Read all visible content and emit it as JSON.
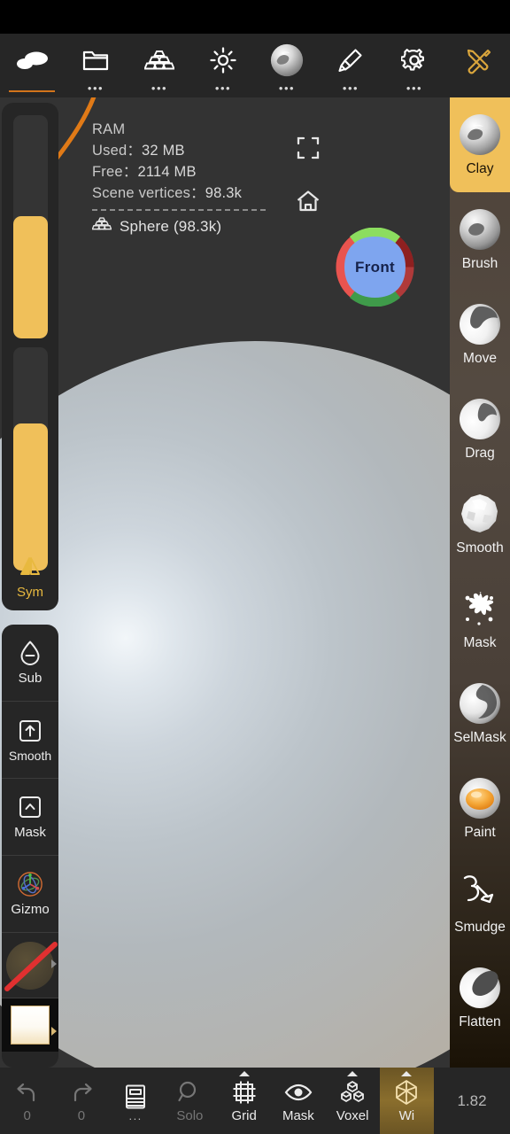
{
  "app": {
    "version": "1.82",
    "accent_gold": "#f0c05a",
    "accent_orange": "#d2741b",
    "panel_bg": "#262626",
    "viewport_bg": "#333333"
  },
  "topbar": {
    "items": [
      {
        "name": "sculpt",
        "icon": "clay-blob-icon",
        "dots": false,
        "active": true
      },
      {
        "name": "files",
        "icon": "folder-icon",
        "dots": true,
        "active": false
      },
      {
        "name": "topology",
        "icon": "stacked-blocks-icon",
        "dots": true,
        "active": false
      },
      {
        "name": "lighting",
        "icon": "sun-icon",
        "dots": true,
        "active": false
      },
      {
        "name": "material",
        "icon": "material-sphere-icon",
        "dots": true,
        "active": false
      },
      {
        "name": "paint",
        "icon": "paintbrush-icon",
        "dots": true,
        "active": false
      },
      {
        "name": "settings",
        "icon": "gear-icon",
        "dots": true,
        "active": false
      },
      {
        "name": "tools",
        "icon": "wrench-screwdriver-icon",
        "dots": false,
        "active": false
      }
    ]
  },
  "scene_info": {
    "ram_title": "RAM",
    "used_label": "Used：",
    "used_value": "32 MB",
    "free_label": "Free：",
    "free_value": "2114 MB",
    "vertices_label": "Scene vertices：",
    "vertices_value": "98.3k",
    "object_name": "Sphere (98.3k)"
  },
  "viewport": {
    "fullscreen_icon": "fullscreen-icon",
    "home_icon": "home-icon",
    "viewcube_label": "Front"
  },
  "left_panel": {
    "brush_size_label": "brush-size",
    "brush_intensity_label": "brush-intensity",
    "sym_label": "Sym",
    "items": [
      {
        "name": "sub",
        "label": "Sub",
        "icon": "droplet-minus-icon"
      },
      {
        "name": "smooth",
        "label": "Smooth",
        "icon": "arrow-up-box-icon"
      },
      {
        "name": "mask",
        "label": "Mask",
        "icon": "chevron-up-box-icon"
      },
      {
        "name": "gizmo",
        "label": "Gizmo",
        "icon": "axis-gizmo-icon"
      }
    ],
    "alpha_swatch": "alpha-disabled",
    "color_swatch": "color-white"
  },
  "right_tools": [
    {
      "name": "clay",
      "label": "Clay",
      "icon": "clay-ball-icon",
      "active": true
    },
    {
      "name": "brush",
      "label": "Brush",
      "icon": "brush-ball-icon",
      "active": false
    },
    {
      "name": "move",
      "label": "Move",
      "icon": "move-ball-icon",
      "active": false
    },
    {
      "name": "drag",
      "label": "Drag",
      "icon": "drag-ball-icon",
      "active": false
    },
    {
      "name": "smooth",
      "label": "Smooth",
      "icon": "smooth-ball-icon",
      "active": false
    },
    {
      "name": "mask",
      "label": "Mask",
      "icon": "mask-splat-icon",
      "active": false
    },
    {
      "name": "selmask",
      "label": "SelMask",
      "icon": "selmask-ball-icon",
      "active": false
    },
    {
      "name": "paint",
      "label": "Paint",
      "icon": "paint-ball-icon",
      "active": false
    },
    {
      "name": "smudge",
      "label": "Smudge",
      "icon": "smudge-hand-icon",
      "active": false
    },
    {
      "name": "flatten",
      "label": "Flatten",
      "icon": "flatten-ball-icon",
      "active": false
    }
  ],
  "bottombar": {
    "items": [
      {
        "name": "undo",
        "label": "0",
        "icon": "undo-arrow-icon",
        "dim": true,
        "caret": false,
        "active": false
      },
      {
        "name": "redo",
        "label": "0",
        "icon": "redo-arrow-icon",
        "dim": true,
        "caret": false,
        "active": false
      },
      {
        "name": "layers",
        "label": "...",
        "icon": "layers-book-icon",
        "dim": false,
        "caret": false,
        "active": false,
        "is_dots": true
      },
      {
        "name": "solo",
        "label": "Solo",
        "icon": "magnifier-icon",
        "dim": true,
        "caret": false,
        "active": false
      },
      {
        "name": "grid",
        "label": "Grid",
        "icon": "grid-frame-icon",
        "dim": false,
        "caret": true,
        "active": false
      },
      {
        "name": "mask",
        "label": "Mask",
        "icon": "eye-icon",
        "dim": false,
        "caret": false,
        "active": false
      },
      {
        "name": "voxel",
        "label": "Voxel",
        "icon": "voxel-cubes-icon",
        "dim": false,
        "caret": true,
        "active": false
      },
      {
        "name": "wireframe",
        "label": "Wi",
        "icon": "wireframe-icon",
        "dim": false,
        "caret": true,
        "active": true
      }
    ]
  }
}
